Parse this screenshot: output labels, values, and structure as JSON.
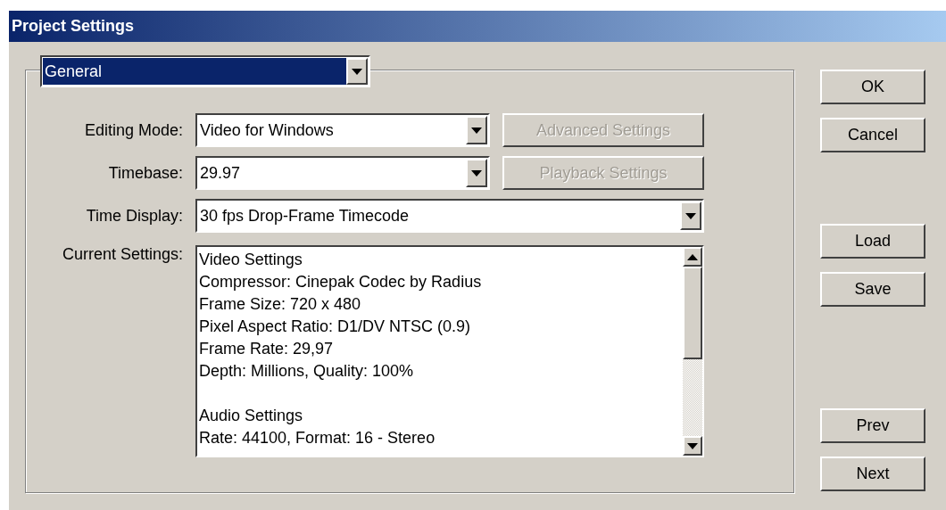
{
  "window": {
    "title": "Project Settings"
  },
  "section_dropdown": {
    "value": "General"
  },
  "rows": [
    {
      "kind": "dropdown",
      "label": "Editing Mode:",
      "value": "Video for Windows",
      "button": {
        "label": "Advanced Settings",
        "disabled": true
      }
    },
    {
      "kind": "dropdown",
      "label": "Timebase:",
      "value": "29.97",
      "button": {
        "label": "Playback Settings",
        "disabled": true
      }
    },
    {
      "kind": "wide_dropdown",
      "label": "Time Display:",
      "value": "30 fps Drop-Frame Timecode"
    },
    {
      "kind": "text_area",
      "label": "Current Settings:",
      "blocks": [
        [
          "Video Settings",
          "Compressor: Cinepak Codec by Radius",
          "Frame Size: 720 x 480",
          "Pixel Aspect Ratio: D1/DV NTSC (0.9)",
          "Frame Rate: 29,97",
          "Depth: Millions, Quality: 100%"
        ],
        [
          "Audio Settings",
          "Rate: 44100, Format: 16 - Stereo"
        ]
      ]
    }
  ],
  "side_buttons": [
    [
      "OK",
      "Cancel"
    ],
    [
      "Load",
      "Save"
    ],
    [
      "Prev",
      "Next"
    ]
  ]
}
